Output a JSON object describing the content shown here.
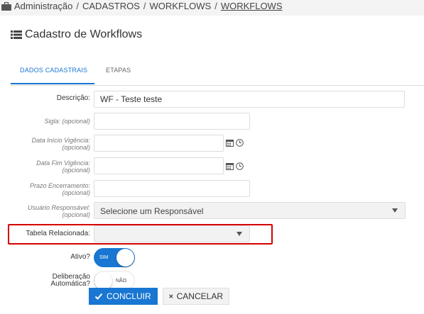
{
  "breadcrumb": {
    "items": [
      "Administração",
      "CADASTROS",
      "WORKFLOWS",
      "WORKFLOWS"
    ],
    "separator": "/"
  },
  "page": {
    "title": "Cadastro de Workflows"
  },
  "tabs": [
    {
      "label": "DADOS CADASTRAIS",
      "active": true
    },
    {
      "label": "ETAPAS",
      "active": false
    }
  ],
  "form": {
    "descricao": {
      "label": "Descrição:",
      "value": "WF - Teste teste"
    },
    "sigla": {
      "label": "Sigla: (opcional)",
      "value": ""
    },
    "data_inicio": {
      "label1": "Data Início Vigência:",
      "label2": "(opcional)",
      "value": ""
    },
    "data_fim": {
      "label1": "Data Fim Vigência:",
      "label2": "(opcional)",
      "value": ""
    },
    "prazo": {
      "label1": "Prazo Encerramento:",
      "label2": "(opcional)",
      "value": ""
    },
    "responsavel": {
      "label1": "Usuário Responsável:",
      "label2": "(opcional)",
      "value": "Selecione um Responsável"
    },
    "tabela": {
      "label": "Tabela Relacionada:",
      "value": ""
    },
    "ativo": {
      "label": "Ativo?",
      "state_text": "SIM",
      "on": true
    },
    "deliberacao": {
      "label1": "Deliberação",
      "label2": "Automática?",
      "state_text": "NÃO",
      "on": false
    }
  },
  "actions": {
    "confirm": "CONCLUIR",
    "cancel": "CANCELAR"
  },
  "colors": {
    "accent": "#1976d2",
    "highlight": "#d50000"
  }
}
